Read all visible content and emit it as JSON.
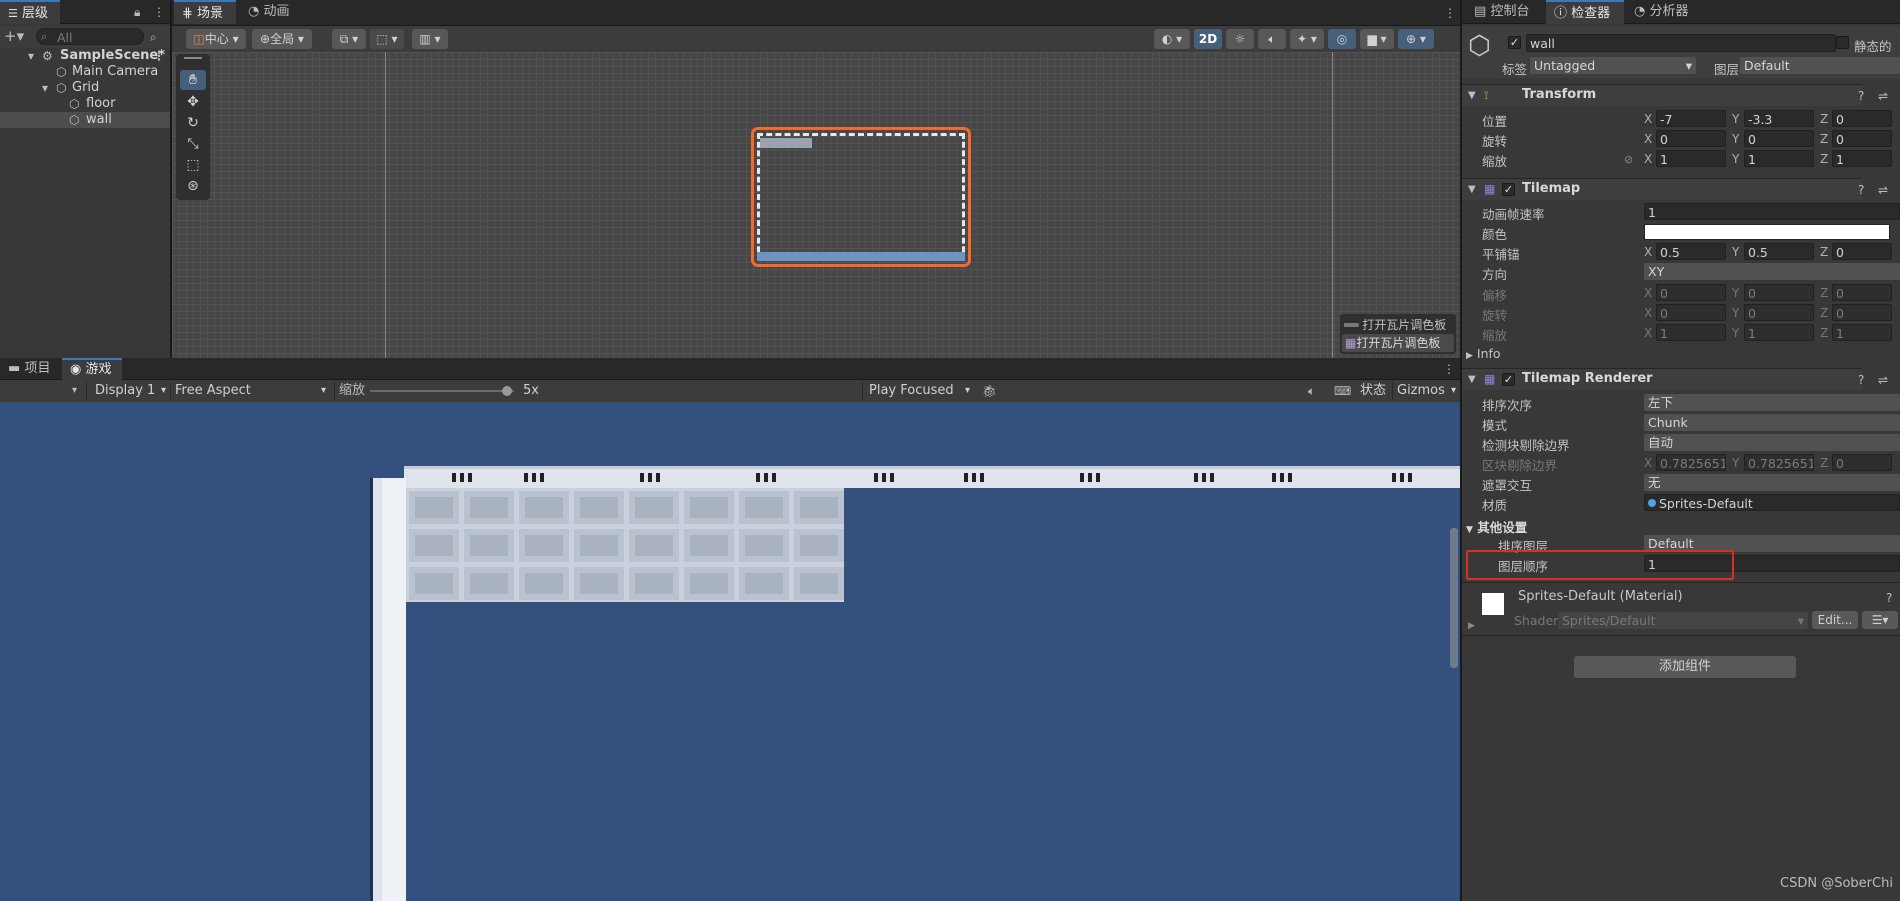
{
  "hierarchy": {
    "tab": "层级",
    "search_placeholder": "All",
    "items": [
      {
        "label": "SampleScene*"
      },
      {
        "label": "Main Camera"
      },
      {
        "label": "Grid"
      },
      {
        "label": "floor"
      },
      {
        "label": "wall"
      }
    ]
  },
  "scene": {
    "tabs": [
      "场景",
      "动画"
    ],
    "pivot": "中心",
    "space": "全局",
    "mode_2d": "2D",
    "palette_overlay": [
      "打开瓦片调色板",
      "打开瓦片调色板"
    ]
  },
  "bottom": {
    "tabs": [
      "项目",
      "游戏"
    ],
    "display": "Display 1",
    "aspect": "Free Aspect",
    "scale_label": "缩放",
    "scale_value": "5x",
    "scale_fraction": 0.95,
    "play_mode": "Play Focused",
    "stats": "状态",
    "gizmos": "Gizmos"
  },
  "inspector": {
    "tabs": [
      "控制台",
      "检查器",
      "分析器"
    ],
    "object_name": "wall",
    "static_label": "静态的",
    "tag_label": "标签",
    "tag_value": "Untagged",
    "layer_label": "图层",
    "layer_value": "Default",
    "transform": {
      "title": "Transform",
      "rows": [
        {
          "label": "位置",
          "x": "-7",
          "y": "-3.3",
          "z": "0"
        },
        {
          "label": "旋转",
          "x": "0",
          "y": "0",
          "z": "0"
        },
        {
          "label": "缩放",
          "x": "1",
          "y": "1",
          "z": "1"
        }
      ]
    },
    "tilemap": {
      "title": "Tilemap",
      "frame_rate_label": "动画帧速率",
      "frame_rate": "1",
      "color_label": "颜色",
      "anchor_label": "平铺锚",
      "anchor": {
        "x": "0.5",
        "y": "0.5",
        "z": "0"
      },
      "orientation_label": "方向",
      "orientation": "XY",
      "disabled_rows": [
        {
          "label": "偏移",
          "x": "0",
          "y": "0",
          "z": "0"
        },
        {
          "label": "旋转",
          "x": "0",
          "y": "0",
          "z": "0"
        },
        {
          "label": "缩放",
          "x": "1",
          "y": "1",
          "z": "1"
        }
      ],
      "info_label": "Info"
    },
    "renderer": {
      "title": "Tilemap Renderer",
      "sort_order_label": "排序次序",
      "sort_order": "左下",
      "mode_label": "模式",
      "mode": "Chunk",
      "detect_bounds_label": "检测块剔除边界",
      "detect_bounds": "自动",
      "chunk_bounds_label": "区块剔除边界",
      "chunk_bounds": {
        "x": "0.7825651",
        "y": "0.7825651",
        "z": "0"
      },
      "mask_label": "遮罩交互",
      "mask": "无",
      "material_label": "材质",
      "material": "Sprites-Default",
      "other_settings": "其他设置",
      "sorting_layer_label": "排序图层",
      "sorting_layer": "Default",
      "order_label": "图层顺序",
      "order": "1"
    },
    "material_block": {
      "name": "Sprites-Default (Material)",
      "shader_label": "Shader",
      "shader": "Sprites/Default",
      "edit": "Edit..."
    },
    "add_component": "添加组件"
  },
  "watermark": "CSDN @SoberChi",
  "colors": {
    "accent": "#3a79bb",
    "highlight_box": "#d93025",
    "game_bg": "#34507f",
    "selection_outline": "#f26b2a"
  }
}
